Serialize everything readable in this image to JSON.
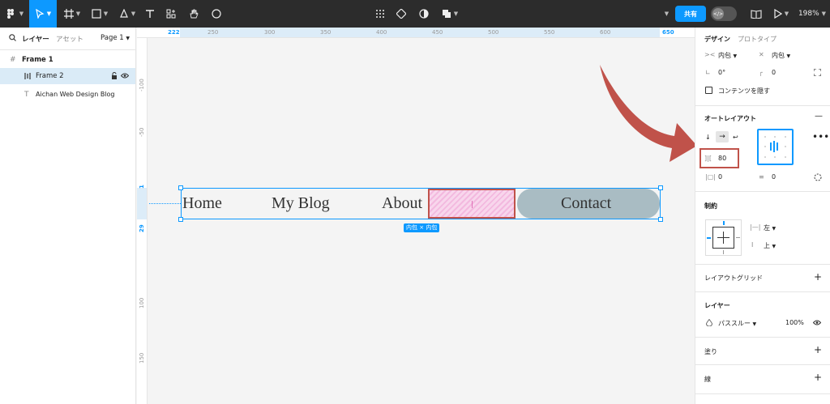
{
  "toolbar": {
    "share_label": "共有",
    "zoom": "198%",
    "accent": "#0d99ff",
    "bg": "#2c2c2c"
  },
  "left": {
    "tabs": {
      "layers": "レイヤー",
      "assets": "アセット",
      "page": "Page 1"
    },
    "layers": [
      {
        "name": "Frame 1",
        "icon": "frame-icon"
      },
      {
        "name": "Frame 2",
        "icon": "autolayout-icon"
      },
      {
        "name": "Aichan Web Design Blog",
        "icon": "text-icon"
      }
    ]
  },
  "rulers": {
    "top": [
      "222",
      "250",
      "300",
      "350",
      "400",
      "450",
      "500",
      "550",
      "600",
      "650"
    ],
    "left": [
      "-100",
      "-50",
      "1",
      "29",
      "100",
      "150"
    ]
  },
  "canvas": {
    "nav": [
      "Home",
      "My Blog",
      "About",
      "Contact"
    ],
    "size_badge": "内包 × 内包",
    "contact_bg": "#a9bcc3",
    "highlight": "#c0524a"
  },
  "right": {
    "tabs": {
      "design": "デザイン",
      "prototype": "プロトタイプ"
    },
    "w_mode": "内包",
    "h_mode": "内包",
    "rotation": "0°",
    "radius": "0",
    "clip_label": "コンテンツを隠す",
    "autolayout_title": "オートレイアウト",
    "gap": "80",
    "pad_h": "0",
    "pad_v": "0",
    "constraints_title": "制約",
    "constraint_h": "左",
    "constraint_v": "上",
    "layout_grid": "レイアウトグリッド",
    "layer_title": "レイヤー",
    "blend": "パススルー",
    "opacity": "100%",
    "fill": "塗り",
    "stroke": "線"
  }
}
